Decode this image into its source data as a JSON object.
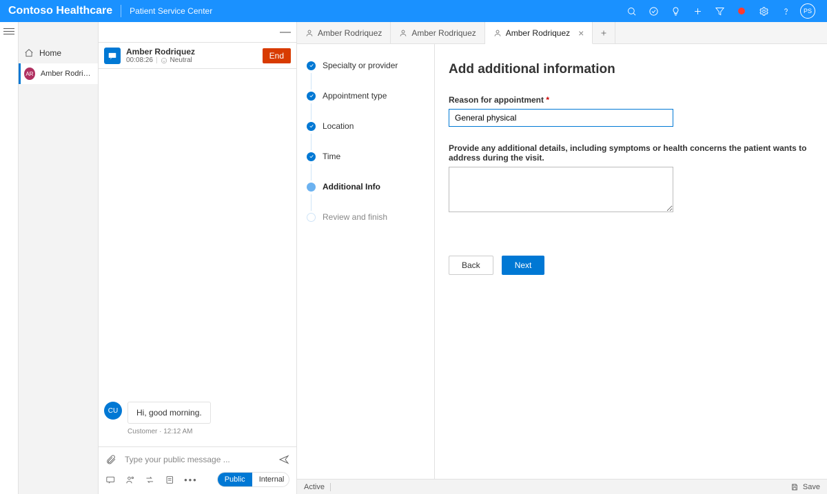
{
  "header": {
    "brand": "Contoso Healthcare",
    "app": "Patient Service Center",
    "avatar_initials": "PS"
  },
  "nav": {
    "home_label": "Home",
    "session": {
      "initials": "AR",
      "name": "Amber Rodriquez"
    }
  },
  "conversation": {
    "title": "Amber Rodriquez",
    "timer": "00:08:26",
    "sentiment": "Neutral",
    "end_label": "End",
    "message": {
      "avatar": "CU",
      "text": "Hi, good morning.",
      "meta": "Customer · 12:12 AM"
    },
    "compose_placeholder": "Type your public message ...",
    "pill": {
      "public": "Public",
      "internal": "Internal"
    }
  },
  "tabs": {
    "bg1": "Amber Rodriquez",
    "bg2": "Amber Rodriquez",
    "active": "Amber Rodriquez"
  },
  "stepper": {
    "s1": "Specialty or provider",
    "s2": "Appointment type",
    "s3": "Location",
    "s4": "Time",
    "s5": "Additional Info",
    "s6": "Review and finish"
  },
  "form": {
    "title": "Add additional information",
    "reason_label": "Reason for appointment",
    "reason_value": "General physical",
    "details_label": "Provide any additional details, including symptoms or health concerns the patient wants to address during the visit.",
    "back": "Back",
    "next": "Next"
  },
  "status": {
    "active": "Active",
    "save": "Save"
  }
}
